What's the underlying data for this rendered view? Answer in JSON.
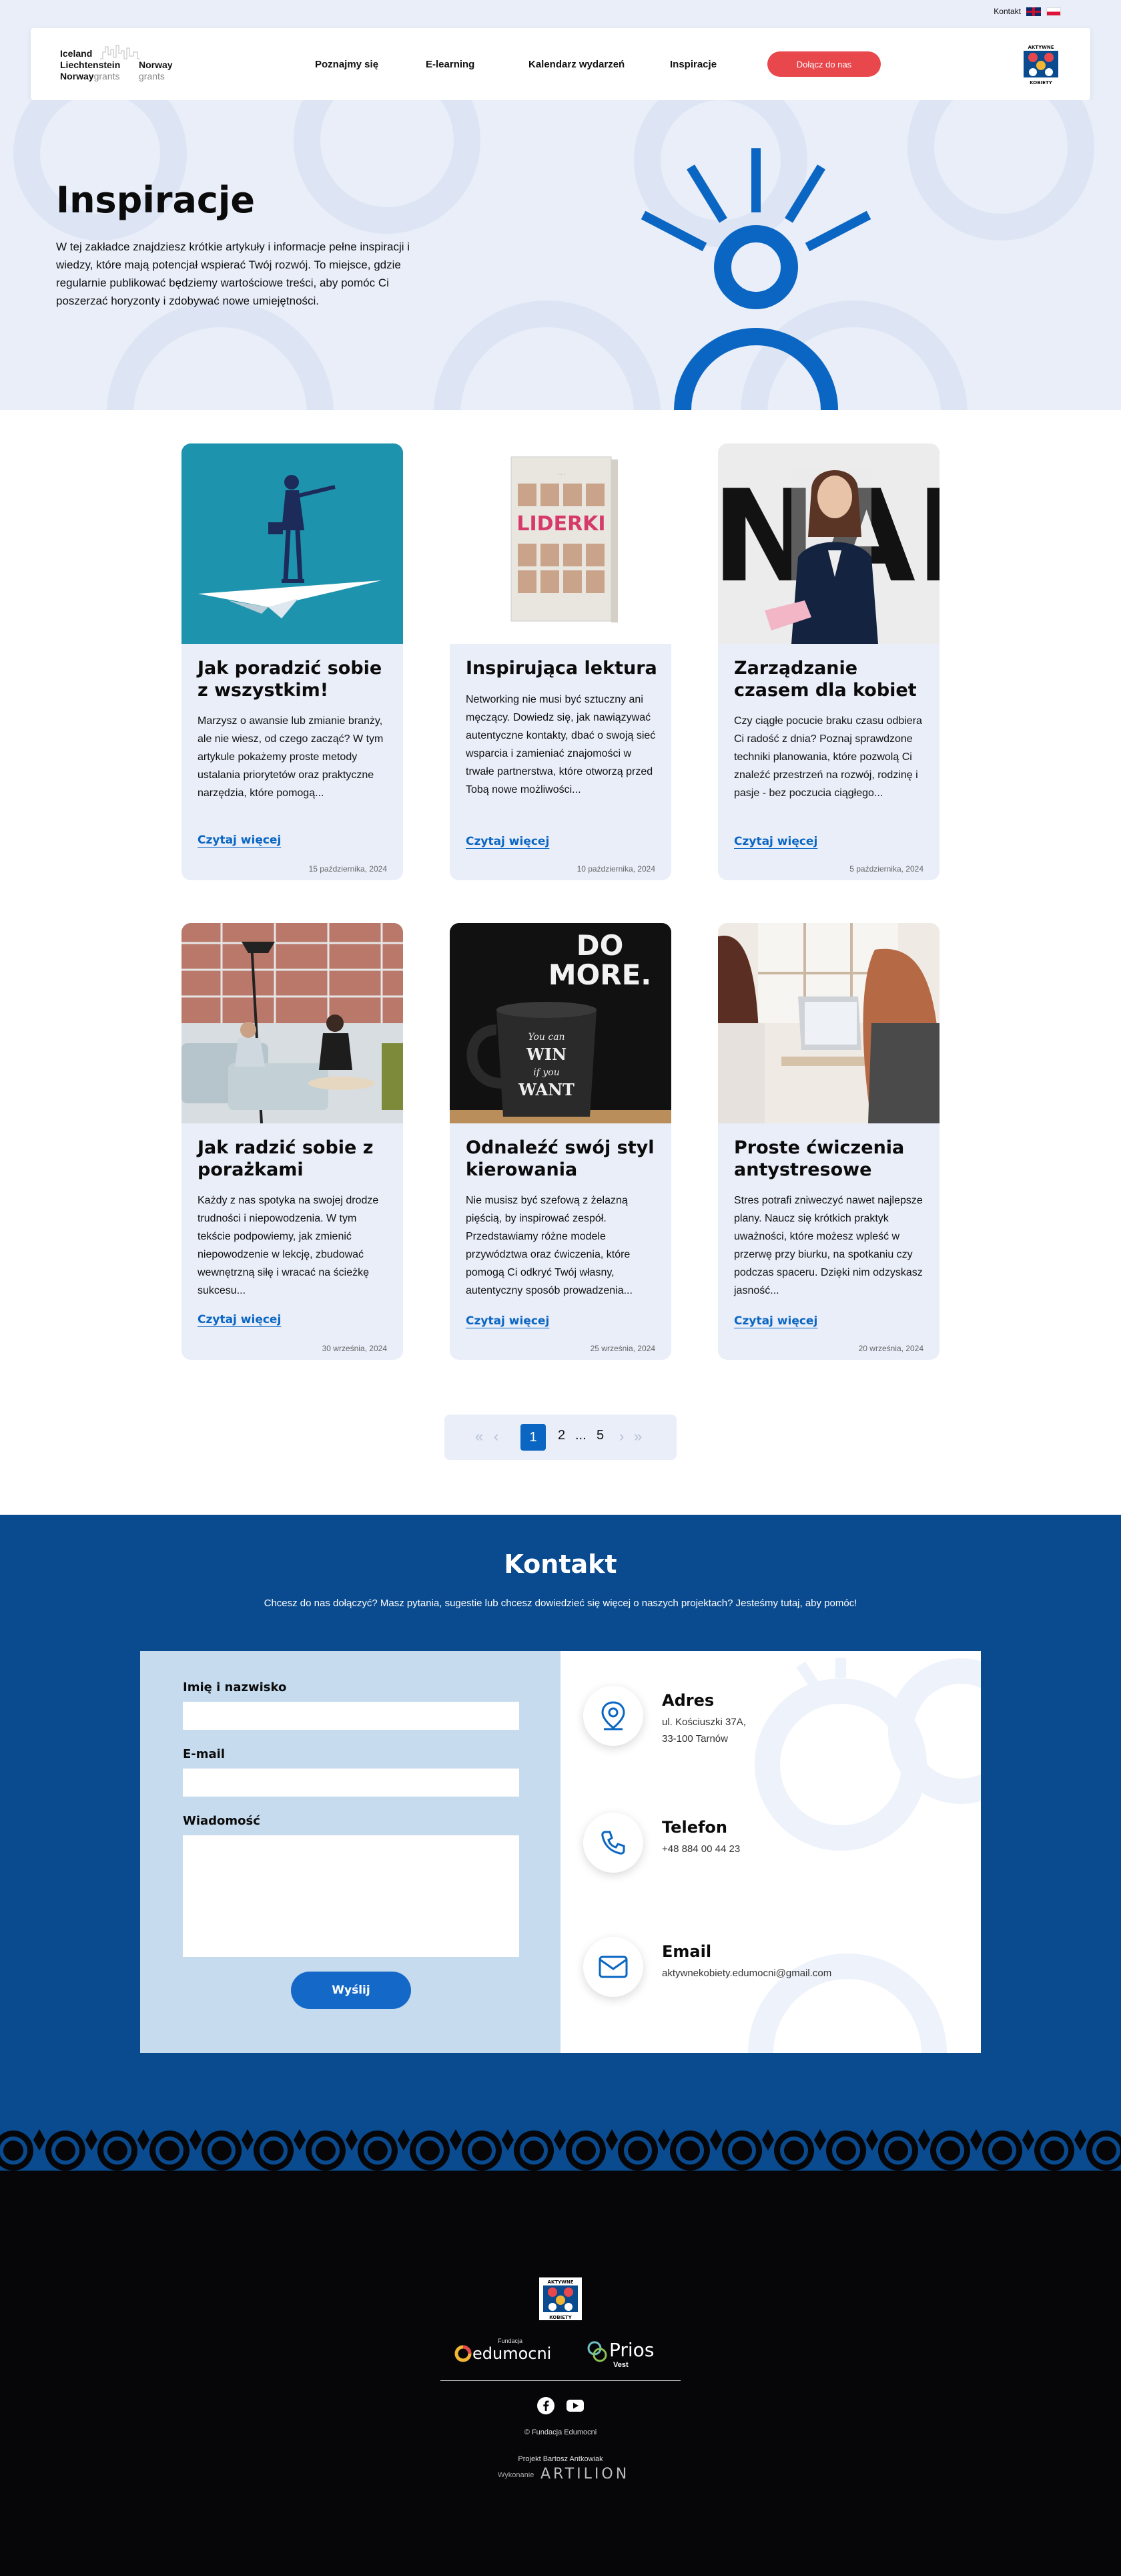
{
  "topbar": {
    "contact_link": "Kontakt",
    "languages": [
      "en-flag-icon",
      "pl-flag-icon"
    ]
  },
  "header": {
    "grants_logo": {
      "left": [
        "Iceland",
        "Liechtenstein",
        "Norway"
      ],
      "right": [
        "Norway"
      ],
      "sub": "grants"
    },
    "nav": [
      "Poznajmy się",
      "E-learning",
      "Kalendarz wydarzeń",
      "Inspiracje"
    ],
    "join_button": "Dołącz do nas",
    "ak_logo_text": [
      "AKTYWNE",
      "KOBIETY"
    ]
  },
  "hero": {
    "title": "Inspiracje",
    "text": "W tej zakładce znajdziesz krótkie artykuły i informacje pełne inspiracji i wiedzy, które mają potencjał wspierać Twój rozwój. To miejsce, gdzie regularnie publikować będziemy wartościowe treści, aby pomóc Ci poszerzać horyzonty i zdobywać nowe umiejętności."
  },
  "articles": [
    {
      "title": "Jak poradzić sobie z wszystkim!",
      "excerpt": "Marzysz o awansie lub zmianie branży, ale nie wiesz, od czego zacząć? W tym artykule pokażemy proste metody ustalania priorytetów oraz praktyczne narzędzia, które pomogą...",
      "more": "Czytaj więcej",
      "date": "15 października, 2024",
      "image": "businesswoman-paper-plane-illustration"
    },
    {
      "title": "Inspirująca lektura",
      "excerpt": "Networking nie musi być sztuczny ani męczący. Dowiedz się, jak nawiązywać autentyczne kontakty, dbać o swoją sieć wsparcia i zamieniać znajomości w trwałe partnerstwa, które otworzą przed Tobą nowe możliwości...",
      "more": "Czytaj więcej",
      "date": "10 października, 2024",
      "image": "liderki-book-cover",
      "book_title": "LIDERKI"
    },
    {
      "title": "Zarządzanie czasem dla kobiet",
      "excerpt": "Czy ciągłe pocucie braku czasu odbiera Ci radość z dnia? Poznaj sprawdzone techniki planowania, które pozwolą Ci znaleźć przestrzeń na rozwój, rodzinę i pasje - bez poczucia ciągłego...",
      "more": "Czytaj więcej",
      "date": "5 października, 2024",
      "image": "woman-speaker-photo",
      "bg_letters": "NAM"
    },
    {
      "title": "Jak radzić sobie z porażkami",
      "excerpt": "Każdy z nas spotyka na swojej drodze trudności i niepowodzenia. W tym tekście podpowiemy, jak zmienić niepowodzenie w lekcję, zbudować wewnętrzną siłę i wracać na ścieżkę sukcesu...",
      "more": "Czytaj więcej",
      "date": "30 września, 2024",
      "image": "office-lounge-photo"
    },
    {
      "title": "Odnaleźć swój styl kierowania",
      "excerpt": "Nie musisz być szefową z żelazną pięścią, by inspirować zespół. Przedstawiamy różne modele przywództwa oraz ćwiczenia, które pomogą Ci odkryć Twój własny, autentyczny sposób prowadzenia...",
      "more": "Czytaj więcej",
      "date": "25 września, 2024",
      "image": "do-more-mug-photo",
      "sign_text": [
        "DO",
        "MORE."
      ],
      "mug_text": [
        "You can",
        "WIN",
        "if you",
        "WANT"
      ]
    },
    {
      "title": "Proste ćwiczenia antystresowe",
      "excerpt": "Stres potrafi zniweczyć nawet najlepsze plany. Naucz się krótkich praktyk uważności, które możesz wpleść w przerwę przy biurku, na spotkaniu czy podczas spaceru. Dzięki nim odzyskasz jasność...",
      "more": "Czytaj więcej",
      "date": "20 września, 2024",
      "image": "laptop-meeting-photo"
    }
  ],
  "pagination": {
    "pages": [
      "1",
      "2",
      "...",
      "5"
    ],
    "current": "1"
  },
  "contact": {
    "title": "Kontakt",
    "subtitle": "Chcesz do nas dołączyć? Masz pytania, sugestie lub chcesz dowiedzieć się więcej o naszych projektach? Jesteśmy tutaj, aby pomóc!",
    "form": {
      "name_label": "Imię i nazwisko",
      "email_label": "E-mail",
      "message_label": "Wiadomość",
      "send": "Wyślij"
    },
    "address": {
      "heading": "Adres",
      "line1": "ul. Kościuszki 37A,",
      "line2": "33-100 Tarnów"
    },
    "phone": {
      "heading": "Telefon",
      "value": "+48 884 00 44 23"
    },
    "email": {
      "heading": "Email",
      "value": "aktywnekobiety.edumocni@gmail.com"
    }
  },
  "footer": {
    "edu_small": "Fundacja",
    "edu_name": "edumocni",
    "prios_name": "Prios",
    "prios_sub": "Vest",
    "copyright": "© Fundacja Edumocni",
    "project": "Projekt Bartosz Antkowiak",
    "wykonanie": "Wykonanie",
    "artilion": "ARTILION"
  },
  "colors": {
    "accent": "#0a66c2",
    "navy": "#0a4b8f",
    "join": "#e8474c",
    "light": "#e9eef9"
  }
}
